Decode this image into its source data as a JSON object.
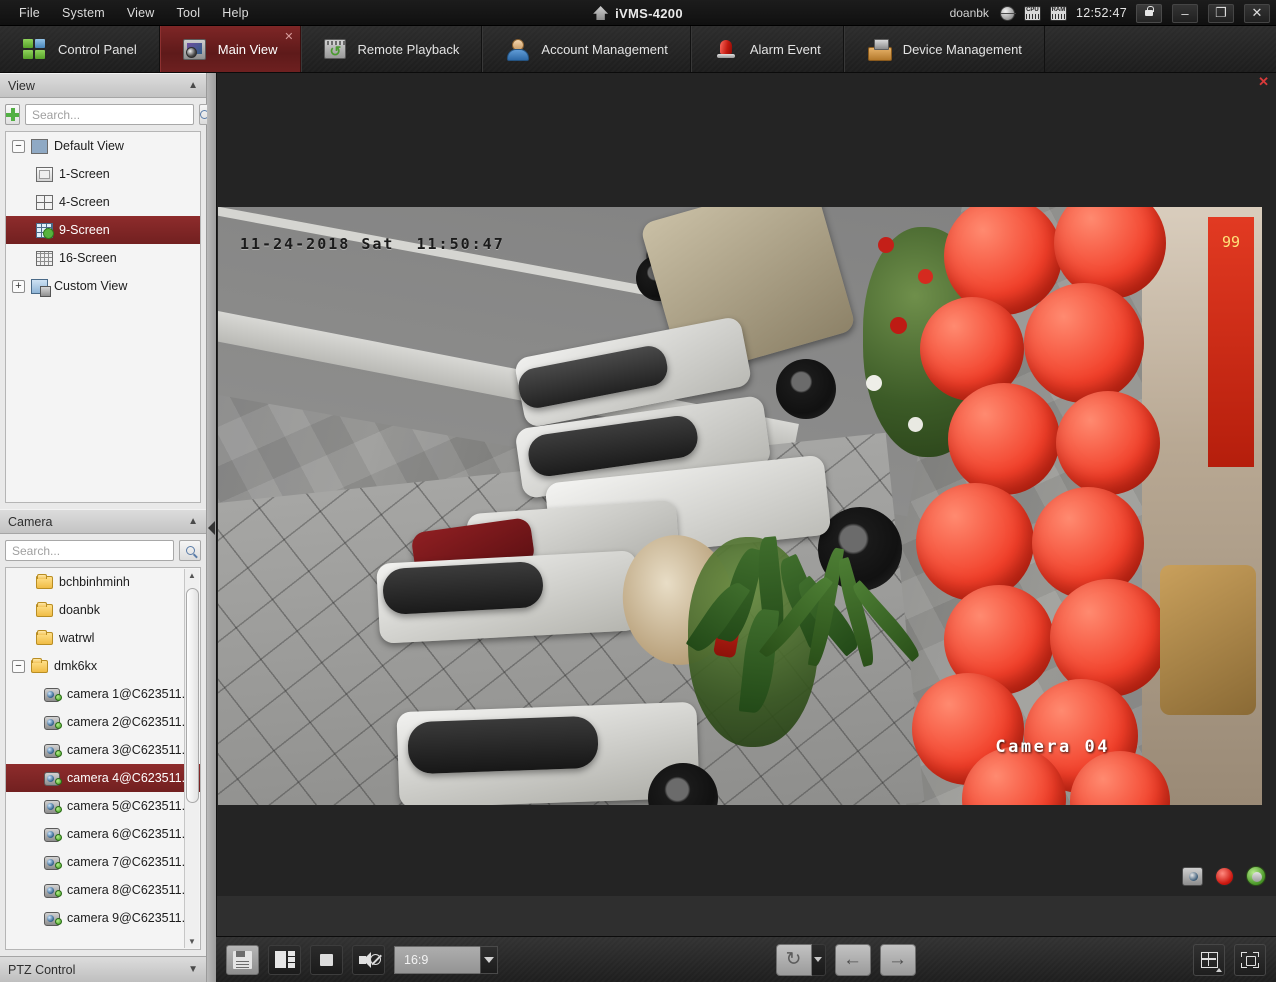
{
  "titlebar": {
    "menu": [
      "File",
      "System",
      "View",
      "Tool",
      "Help"
    ],
    "app_title": "iVMS-4200",
    "user": "doanbk",
    "time": "12:52:47",
    "icons": [
      "globe-icon",
      "cpu-icon",
      "ram-icon",
      "lock-icon"
    ],
    "cpu_label": "CPU",
    "ram_label": "RAM",
    "window_buttons": {
      "minimize": "–",
      "restore": "❐",
      "close": "✕"
    }
  },
  "tabs": [
    {
      "label": "Control Panel",
      "icon": "control-panel-icon",
      "active": false
    },
    {
      "label": "Main View",
      "icon": "main-view-icon",
      "active": true,
      "close": "✕"
    },
    {
      "label": "Remote Playback",
      "icon": "remote-playback-icon",
      "active": false
    },
    {
      "label": "Account Management",
      "icon": "account-management-icon",
      "active": false
    },
    {
      "label": "Alarm Event",
      "icon": "alarm-event-icon",
      "active": false
    },
    {
      "label": "Device Management",
      "icon": "device-management-icon",
      "active": false
    }
  ],
  "view_panel": {
    "title": "View",
    "collapse_chevron": "▲",
    "add_button": "add-view-button",
    "search_placeholder": "Search...",
    "search_value": "",
    "tree": [
      {
        "label": "Default View",
        "level": 0,
        "expander": "−",
        "icon": "grid-view-icon",
        "selected": false
      },
      {
        "label": "1-Screen",
        "level": 1,
        "icon": "screen-1-icon",
        "selected": false
      },
      {
        "label": "4-Screen",
        "level": 1,
        "icon": "screen-4-icon",
        "selected": false
      },
      {
        "label": "9-Screen",
        "level": 1,
        "icon": "screen-9-icon",
        "selected": true
      },
      {
        "label": "16-Screen",
        "level": 1,
        "icon": "screen-16-icon",
        "selected": false
      },
      {
        "label": "Custom View",
        "level": 0,
        "expander": "+",
        "icon": "custom-view-icon",
        "selected": false
      }
    ]
  },
  "camera_panel": {
    "title": "Camera",
    "collapse_chevron": "▲",
    "search_placeholder": "Search...",
    "search_value": "",
    "tree": [
      {
        "label": "bchbinhminh",
        "type": "folder",
        "level": 1,
        "selected": false
      },
      {
        "label": "doanbk",
        "type": "folder",
        "level": 1,
        "selected": false
      },
      {
        "label": "watrwl",
        "type": "folder",
        "level": 1,
        "selected": false
      },
      {
        "label": "dmk6kx",
        "type": "folder",
        "level": 0,
        "expander": "−",
        "selected": false
      },
      {
        "label": "camera 1@C623511...",
        "type": "camera",
        "level": 2,
        "selected": false
      },
      {
        "label": "camera 2@C623511...",
        "type": "camera",
        "level": 2,
        "selected": false
      },
      {
        "label": "camera 3@C623511...",
        "type": "camera",
        "level": 2,
        "selected": false
      },
      {
        "label": "camera 4@C623511...",
        "type": "camera",
        "level": 2,
        "selected": true
      },
      {
        "label": "camera 5@C623511...",
        "type": "camera",
        "level": 2,
        "selected": false
      },
      {
        "label": "camera 6@C623511...",
        "type": "camera",
        "level": 2,
        "selected": false
      },
      {
        "label": "camera 7@C623511...",
        "type": "camera",
        "level": 2,
        "selected": false
      },
      {
        "label": "camera 8@C623511...",
        "type": "camera",
        "level": 2,
        "selected": false
      },
      {
        "label": "camera 9@C623511...",
        "type": "camera",
        "level": 2,
        "selected": false
      }
    ],
    "scroll_up": "▲",
    "scroll_down": "▼"
  },
  "ptz_panel": {
    "title": "PTZ Control",
    "expand_chevron": "▼"
  },
  "video": {
    "osd_timestamp": "11-24-2018 Sat  11:50:47",
    "camera_label": "Camera 04",
    "close_button": "✕",
    "status_icons": [
      "snapshot-icon",
      "record-icon",
      "ptz-icon"
    ],
    "banner_text": "99"
  },
  "toolbar": {
    "save_view_label": "save-view-button",
    "layout_label": "layout-button",
    "stop_all_label": "stop-all-button",
    "mute_label": "mute-button",
    "aspect_ratio": "16:9",
    "aspect_caret": "▼",
    "loop_label": "loop-button",
    "loop_caret": "▼",
    "previous_label": "←",
    "next_label": "→",
    "window_division_label": "window-division-button",
    "fullscreen_label": "fullscreen-button"
  }
}
